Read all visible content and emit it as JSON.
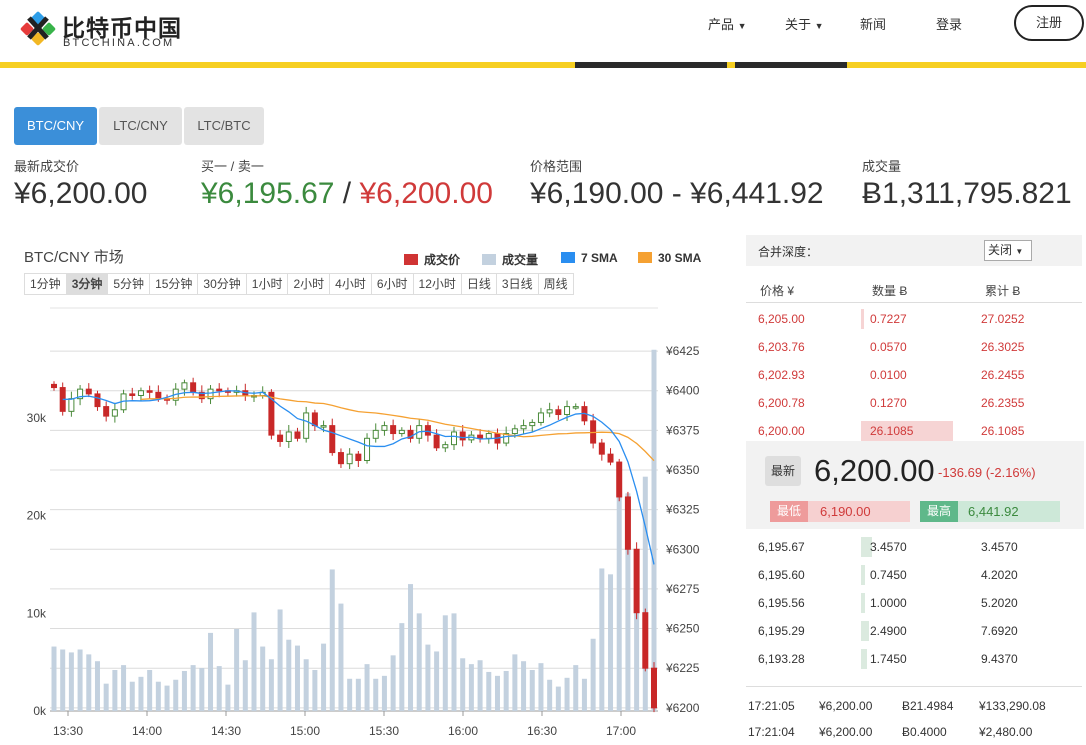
{
  "brand": {
    "name": "比特币中国",
    "sub": "BTCCHINA.COM"
  },
  "nav": {
    "items": [
      "产品",
      "关于",
      "新闻",
      "登录"
    ],
    "register": "注册"
  },
  "tabs": [
    "BTC/CNY",
    "LTC/CNY",
    "LTC/BTC"
  ],
  "stats": {
    "last_label": "最新成交价",
    "last_value": "¥6,200.00",
    "bidask_label": "买一 / 卖一",
    "bid": "¥6,195.67",
    "sep": " / ",
    "ask": "¥6,200.00",
    "range_label": "价格范围",
    "range_value": "¥6,190.00 - ¥6,441.92",
    "volume_label": "成交量",
    "volume_value": "Ƀ1,311,795.821"
  },
  "chart": {
    "title": "BTC/CNY 市场",
    "legend": [
      {
        "label": "成交价",
        "color": "#d03434"
      },
      {
        "label": "成交量",
        "color": "#c3d1df"
      },
      {
        "label": "7 SMA",
        "color": "#2a8ef0"
      },
      {
        "label": "30 SMA",
        "color": "#f5a132"
      }
    ],
    "intervals": [
      "1分钟",
      "3分钟",
      "5分钟",
      "15分钟",
      "30分钟",
      "1小时",
      "2小时",
      "4小时",
      "6小时",
      "12小时",
      "日线",
      "3日线",
      "周线"
    ],
    "active_interval": "3分钟"
  },
  "chart_data": {
    "type": "candlestick",
    "x_ticks": [
      "13:30",
      "14:00",
      "14:30",
      "15:00",
      "15:30",
      "16:00",
      "16:30",
      "17:00"
    ],
    "price_ticks": [
      "¥6425",
      "¥6400",
      "¥6375",
      "¥6350",
      "¥6325",
      "¥6300",
      "¥6275",
      "¥6250",
      "¥6225",
      "¥6200"
    ],
    "price_range": [
      6198,
      6432
    ],
    "volume_ticks": [
      "30k",
      "20k",
      "10k",
      "0k"
    ],
    "volume_range": [
      0,
      38000
    ],
    "closes": [
      6402,
      6387,
      6395,
      6401,
      6398,
      6390,
      6384,
      6388,
      6398,
      6397,
      6400,
      6399,
      6395,
      6394,
      6401,
      6405,
      6399,
      6395,
      6401,
      6400,
      6399,
      6400,
      6397,
      6397,
      6399,
      6372,
      6368,
      6374,
      6370,
      6386,
      6378,
      6378,
      6361,
      6354,
      6360,
      6356,
      6370,
      6375,
      6378,
      6373,
      6375,
      6370,
      6378,
      6372,
      6364,
      6366,
      6374,
      6369,
      6372,
      6370,
      6373,
      6367,
      6373,
      6376,
      6378,
      6380,
      6386,
      6388,
      6385,
      6390,
      6390,
      6381,
      6367,
      6360,
      6355,
      6333,
      6300,
      6260,
      6225,
      6200
    ],
    "volumes": [
      6600,
      6300,
      6000,
      6300,
      5800,
      5100,
      2800,
      4200,
      4700,
      3000,
      3500,
      4200,
      3000,
      2600,
      3200,
      4100,
      4700,
      4400,
      8000,
      4600,
      2700,
      8400,
      5200,
      10100,
      6600,
      5300,
      10400,
      7300,
      6700,
      5300,
      4200,
      6900,
      14500,
      11000,
      3300,
      3300,
      4800,
      3300,
      3600,
      5700,
      9000,
      13000,
      10000,
      6800,
      6100,
      9800,
      10000,
      5400,
      4800,
      5200,
      4000,
      3600,
      4100,
      5800,
      5100,
      4200,
      4900,
      3200,
      2500,
      3400,
      4700,
      3300,
      7400,
      14600,
      14000,
      22700,
      22300,
      13800,
      24000,
      37000
    ]
  },
  "book": {
    "merge_label": "合并深度：",
    "merge_value": "关闭",
    "headers": [
      "价格 ¥",
      "数量 Ƀ",
      "累计 Ƀ"
    ],
    "asks": [
      {
        "price": "6,205.00",
        "qty": "0.7227",
        "total": "27.0252",
        "depth": 0.03
      },
      {
        "price": "6,203.76",
        "qty": "0.0570",
        "total": "26.3025",
        "depth": 0.0
      },
      {
        "price": "6,202.93",
        "qty": "0.0100",
        "total": "26.2455",
        "depth": 0.0
      },
      {
        "price": "6,200.78",
        "qty": "0.1270",
        "total": "26.2355",
        "depth": 0.0
      },
      {
        "price": "6,200.00",
        "qty": "26.1085",
        "total": "26.1085",
        "depth": 1.0
      }
    ],
    "last_label": "最新",
    "last_price": "6,200.00",
    "change": "-136.69 (-2.16%)",
    "low_label": "最低",
    "low": "6,190.00",
    "high_label": "最高",
    "high": "6,441.92",
    "bids": [
      {
        "price": "6,195.67",
        "qty": "3.4570",
        "total": "3.4570",
        "depth": 0.12
      },
      {
        "price": "6,195.60",
        "qty": "0.7450",
        "total": "4.2020",
        "depth": 0.03
      },
      {
        "price": "6,195.56",
        "qty": "1.0000",
        "total": "5.2020",
        "depth": 0.04
      },
      {
        "price": "6,195.29",
        "qty": "2.4900",
        "total": "7.6920",
        "depth": 0.09
      },
      {
        "price": "6,193.28",
        "qty": "1.7450",
        "total": "9.4370",
        "depth": 0.07
      }
    ]
  },
  "trades": [
    {
      "time": "17:21:05",
      "price": "¥6,200.00",
      "qty": "Ƀ21.4984",
      "total": "¥133,290.08"
    },
    {
      "time": "17:21:04",
      "price": "¥6,200.00",
      "qty": "Ƀ0.4000",
      "total": "¥2,480.00"
    }
  ]
}
